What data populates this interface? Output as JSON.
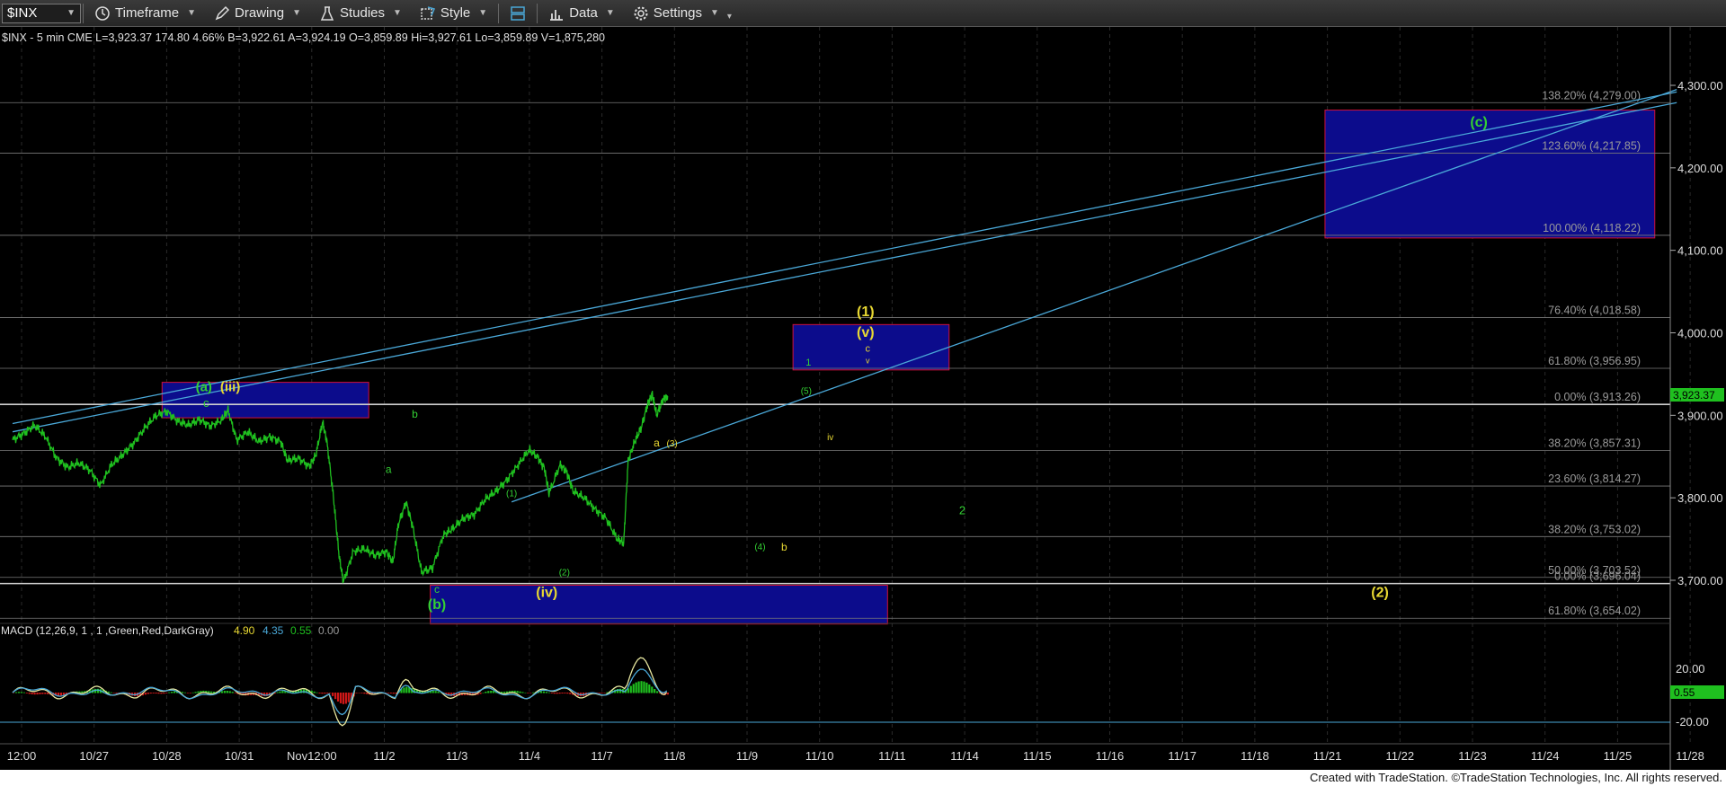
{
  "toolbar": {
    "symbol": "$INX",
    "timeframe_label": "Timeframe",
    "drawing_label": "Drawing",
    "studies_label": "Studies",
    "style_label": "Style",
    "data_label": "Data",
    "settings_label": "Settings"
  },
  "footer": {
    "text": "Created with TradeStation. ©TradeStation Technologies, Inc. All rights reserved."
  },
  "chart_data": {
    "type": "line",
    "title": "$INX - 5 min  CME  L=3,923.37  174.80  4.66%  B=3,922.61  A=3,924.19  O=3,859.89  Hi=3,927.61  Lo=3,859.89  V=1,875,280",
    "colors": {
      "price": "#1fc01f",
      "fib": "#7a7a7a",
      "trend": "#4aa8d8",
      "box_fill": "#0c0c8c",
      "box_border": "#d0103a",
      "green_label": "#33d033",
      "yellow_label": "#e8d832"
    },
    "y_axis": {
      "ticks": [
        4300,
        4200,
        4100,
        4000,
        3900,
        3800,
        3700
      ],
      "tick_labels": [
        "4,300.00",
        "4,200.00",
        "4,100.00",
        "4,000.00",
        "3,900.00",
        "3,800.00",
        "3,700.00"
      ],
      "last_price_label": "3,923.37"
    },
    "x_axis": {
      "labels": [
        "12:00",
        "10/27",
        "10/28",
        "10/31",
        "Nov12:00",
        "11/2",
        "11/3",
        "11/4",
        "11/7",
        "11/8",
        "11/9",
        "11/10",
        "11/11",
        "11/14",
        "11/15",
        "11/16",
        "11/17",
        "11/18",
        "11/21",
        "11/22",
        "11/23",
        "11/24",
        "11/25",
        "11/28"
      ]
    },
    "price_path": [
      [
        0,
        3870
      ],
      [
        0.5,
        3878
      ],
      [
        1,
        3888
      ],
      [
        1.5,
        3874
      ],
      [
        2,
        3848
      ],
      [
        2.5,
        3837
      ],
      [
        3,
        3842
      ],
      [
        3.5,
        3834
      ],
      [
        4,
        3815
      ],
      [
        4.5,
        3840
      ],
      [
        5,
        3852
      ],
      [
        5.5,
        3866
      ],
      [
        6,
        3884
      ],
      [
        6.5,
        3899
      ],
      [
        7,
        3905
      ],
      [
        7.5,
        3893
      ],
      [
        8,
        3888
      ],
      [
        8.5,
        3895
      ],
      [
        9,
        3887
      ],
      [
        9.5,
        3894
      ],
      [
        9.8,
        3906
      ],
      [
        10.2,
        3870
      ],
      [
        10.7,
        3880
      ],
      [
        11.2,
        3868
      ],
      [
        11.7,
        3874
      ],
      [
        12.2,
        3868
      ],
      [
        12.5,
        3845
      ],
      [
        13,
        3848
      ],
      [
        13.5,
        3838
      ],
      [
        13.8,
        3852
      ],
      [
        14.1,
        3892
      ],
      [
        14.3,
        3868
      ],
      [
        14.6,
        3800
      ],
      [
        14.85,
        3730
      ],
      [
        15.05,
        3698
      ],
      [
        15.5,
        3735
      ],
      [
        16,
        3738
      ],
      [
        16.5,
        3730
      ],
      [
        17,
        3735
      ],
      [
        17.3,
        3722
      ],
      [
        17.55,
        3768
      ],
      [
        17.9,
        3795
      ],
      [
        18.2,
        3765
      ],
      [
        18.6,
        3710
      ],
      [
        19.1,
        3715
      ],
      [
        19.6,
        3755
      ],
      [
        20,
        3762
      ],
      [
        20.5,
        3775
      ],
      [
        21,
        3780
      ],
      [
        21.5,
        3798
      ],
      [
        22,
        3808
      ],
      [
        22.5,
        3822
      ],
      [
        23,
        3840
      ],
      [
        23.5,
        3858
      ],
      [
        23.9,
        3849
      ],
      [
        24.2,
        3835
      ],
      [
        24.4,
        3805
      ],
      [
        24.9,
        3840
      ],
      [
        25.2,
        3832
      ],
      [
        25.5,
        3808
      ],
      [
        26,
        3800
      ],
      [
        26.5,
        3786
      ],
      [
        27,
        3775
      ],
      [
        27.5,
        3750
      ],
      [
        27.8,
        3745
      ],
      [
        28.0,
        3845
      ],
      [
        28.3,
        3868
      ],
      [
        28.6,
        3885
      ],
      [
        28.9,
        3915
      ],
      [
        29.1,
        3925
      ],
      [
        29.3,
        3900
      ],
      [
        29.6,
        3920
      ],
      [
        29.8,
        3923.37
      ]
    ],
    "macd_label": "MACD (12,26,9, 1 , 1 ,Green,Red,DarkGray)",
    "macd_values": [
      "4.90",
      "4.35",
      "0.55",
      "0.00"
    ],
    "macd_axis": {
      "tick_labels": [
        "20.00",
        "-20.00"
      ],
      "last_value_label": "0.55"
    },
    "fib_levels": [
      {
        "price": 4279.0,
        "label": "138.20% (4,279.00)"
      },
      {
        "price": 4217.85,
        "label": "123.60% (4,217.85)"
      },
      {
        "price": 4118.22,
        "label": "100.00% (4,118.22)"
      },
      {
        "price": 4018.58,
        "label": "76.40% (4,018.58)"
      },
      {
        "price": 3956.95,
        "label": "61.80% (3,956.95)"
      },
      {
        "price": 3913.26,
        "label": "0.00% (3,913.26)"
      },
      {
        "price": 3857.31,
        "label": "38.20% (3,857.31)"
      },
      {
        "price": 3814.27,
        "label": "23.60% (3,814.27)"
      },
      {
        "price": 3753.02,
        "label": "38.20% (3,753.02)"
      },
      {
        "price": 3703.52,
        "label": "50.00% (3,703.52)"
      },
      {
        "price": 3696.04,
        "label": "0.00% (3,696.04)"
      },
      {
        "price": 3654.02,
        "label": "61.80% (3,654.02)"
      }
    ],
    "boxes": [
      {
        "x1": 6.8,
        "x2": 16.2,
        "p1": 3940,
        "p2": 3897
      },
      {
        "x1": 35.5,
        "x2": 42.6,
        "p1": 4010,
        "p2": 3955
      },
      {
        "x1": 19.0,
        "x2": 39.8,
        "p1": 3694,
        "p2": 3647
      },
      {
        "x1": 59.7,
        "x2": 74.7,
        "p1": 4270,
        "p2": 4115
      }
    ],
    "trendlines": [
      {
        "x1": 0,
        "p1": 3890,
        "x2": 75.7,
        "p2": 4292
      },
      {
        "x1": 0,
        "p1": 3880,
        "x2": 75.7,
        "p2": 4279
      },
      {
        "x1": 22.7,
        "p1": 3795,
        "x2": 75.7,
        "p2": 4295
      }
    ],
    "wave_labels": [
      {
        "text": "(a)",
        "x": 8.7,
        "p": 3929,
        "color": "green",
        "size": 15
      },
      {
        "text": "(iii)",
        "x": 9.9,
        "p": 3929,
        "color": "yellow",
        "size": 15
      },
      {
        "text": "c",
        "x": 8.8,
        "p": 3910,
        "color": "green",
        "size": 13
      },
      {
        "text": "b",
        "x": 18.3,
        "p": 3897,
        "color": "green",
        "size": 12
      },
      {
        "text": "a",
        "x": 17.1,
        "p": 3830,
        "color": "green",
        "size": 12
      },
      {
        "text": "(1)",
        "x": 22.7,
        "p": 3802,
        "color": "green",
        "size": 10
      },
      {
        "text": "(2)",
        "x": 25.1,
        "p": 3706,
        "color": "green",
        "size": 10
      },
      {
        "text": "a",
        "x": 29.3,
        "p": 3862,
        "color": "yellow",
        "size": 12
      },
      {
        "text": "(3)",
        "x": 30.0,
        "p": 3862,
        "color": "yellow",
        "size": 10
      },
      {
        "text": "(4)",
        "x": 34.0,
        "p": 3737,
        "color": "green",
        "size": 10
      },
      {
        "text": "b",
        "x": 35.1,
        "p": 3736,
        "color": "yellow",
        "size": 12
      },
      {
        "text": "c",
        "x": 19.3,
        "p": 3685,
        "color": "green",
        "size": 12
      },
      {
        "text": "(b)",
        "x": 19.3,
        "p": 3665,
        "color": "green",
        "size": 16
      },
      {
        "text": "(iv)",
        "x": 24.3,
        "p": 3680,
        "color": "yellow",
        "size": 16
      },
      {
        "text": "(5)",
        "x": 36.1,
        "p": 3926,
        "color": "green",
        "size": 10
      },
      {
        "text": "1",
        "x": 36.2,
        "p": 3960,
        "color": "green",
        "size": 11
      },
      {
        "text": "iv",
        "x": 37.2,
        "p": 3870,
        "color": "yellow",
        "size": 10
      },
      {
        "text": "(1)",
        "x": 38.8,
        "p": 4020,
        "color": "yellow",
        "size": 16
      },
      {
        "text": "(v)",
        "x": 38.8,
        "p": 3995,
        "color": "yellow",
        "size": 16
      },
      {
        "text": "c",
        "x": 38.9,
        "p": 3977,
        "color": "yellow",
        "size": 11
      },
      {
        "text": "v",
        "x": 38.9,
        "p": 3963,
        "color": "yellow",
        "size": 9
      },
      {
        "text": "2",
        "x": 43.2,
        "p": 3780,
        "color": "green",
        "size": 13
      },
      {
        "text": "(c)",
        "x": 66.7,
        "p": 4250,
        "color": "green",
        "size": 16
      },
      {
        "text": "(2)",
        "x": 62.2,
        "p": 3680,
        "color": "yellow",
        "size": 16
      }
    ]
  }
}
